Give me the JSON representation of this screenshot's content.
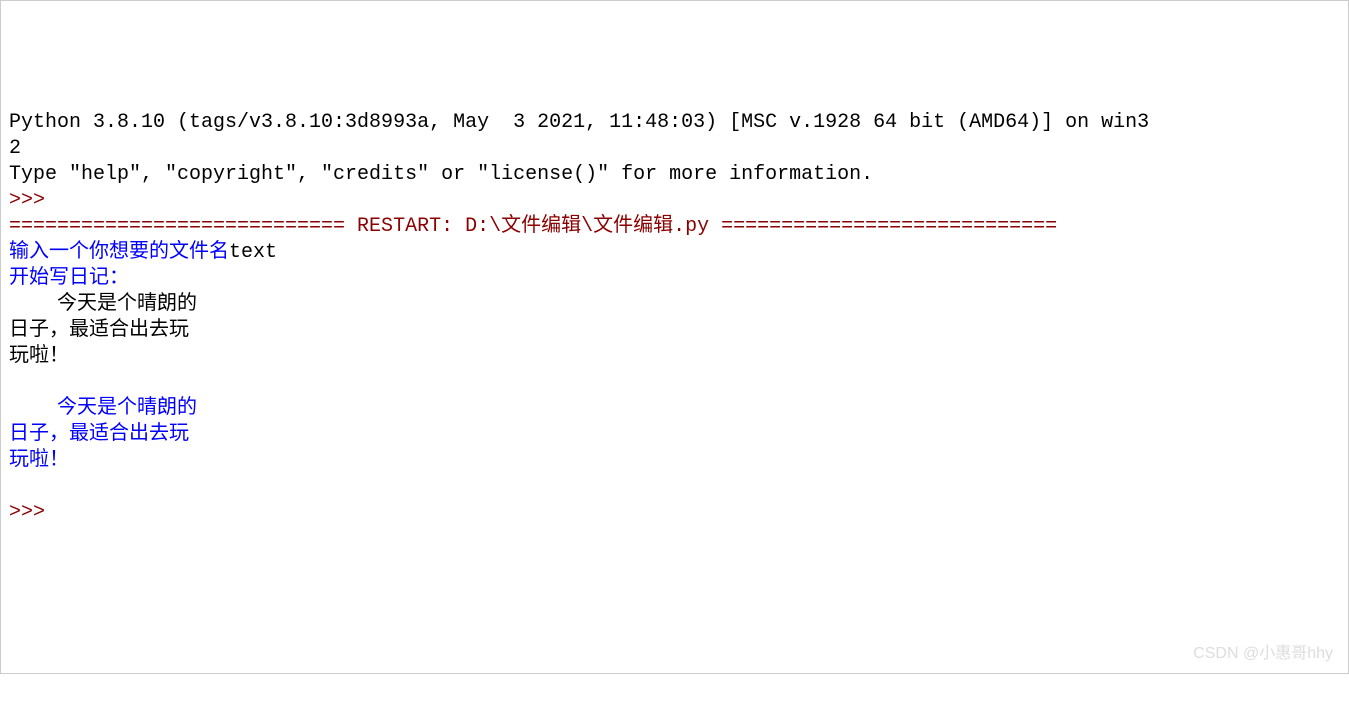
{
  "shell": {
    "header_line1": "Python 3.8.10 (tags/v3.8.10:3d8993a, May  3 2021, 11:48:03) [MSC v.1928 64 bit (AMD64)] on win3",
    "header_line2": "2",
    "header_line3": "Type \"help\", \"copyright\", \"credits\" or \"license()\" for more information.",
    "prompt": ">>> ",
    "restart_line": "============================ RESTART: D:\\文件编辑\\文件编辑.py ============================",
    "input1_prompt": "输入一个你想要的文件名",
    "input1_value": "text",
    "input2_prompt": "开始写日记：",
    "diary_line1": "    今天是个晴朗的",
    "diary_line2": "日子，最适合出去玩",
    "diary_line3": "玩啦！",
    "blank_line": "",
    "output_line1": "    今天是个晴朗的",
    "output_line2": "日子，最适合出去玩",
    "output_line3": "玩啦！",
    "final_prompt": ">>> "
  },
  "watermark": "CSDN @小惠哥hhy"
}
